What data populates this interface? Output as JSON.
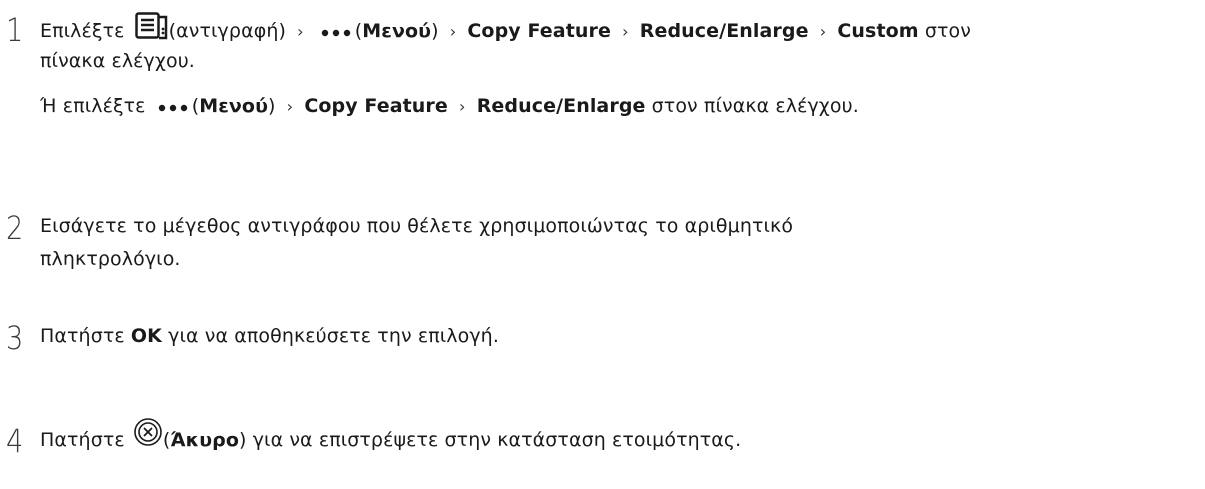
{
  "steps": [
    {
      "number": "1",
      "line1": {
        "choose": "Επιλέξτε",
        "copy_paren": "(αντιγραφή)",
        "menu_open": "(",
        "menu_word": "Μενού",
        "menu_close": ")",
        "copy_feature": "Copy Feature",
        "reduce_enlarge": "Reduce/Enlarge",
        "custom": "Custom",
        "tail": "στον"
      },
      "line2": "πίνακα ελέγχου.",
      "alt": {
        "prefix": "Ή επιλέξτε",
        "menu_open": "(",
        "menu_word": "Μενού",
        "menu_close": ")",
        "copy_feature": "Copy Feature",
        "reduce_enlarge": "Reduce/Enlarge",
        "tail": "στον πίνακα ελέγχου."
      }
    },
    {
      "number": "2",
      "line1": "Εισάγετε το μέγεθος αντιγράφου που θέλετε χρησιμοποιώντας το αριθμητικό",
      "line2": "πληκτρολόγιο."
    },
    {
      "number": "3",
      "prefix": "Πατήστε",
      "ok": "OK",
      "tail": "για να αποθηκεύσετε την επιλογή."
    },
    {
      "number": "4",
      "prefix": "Πατήστε",
      "paren_open": "(",
      "cancel": "Άκυρο",
      "paren_close": ")",
      "tail": "για να επιστρέψετε στην κατάσταση ετοιμότητας."
    }
  ],
  "icons": {
    "copy": "copy-icon",
    "menu": "more-dots-icon",
    "cancel": "cancel-icon",
    "separator": "chevron-right-icon"
  }
}
